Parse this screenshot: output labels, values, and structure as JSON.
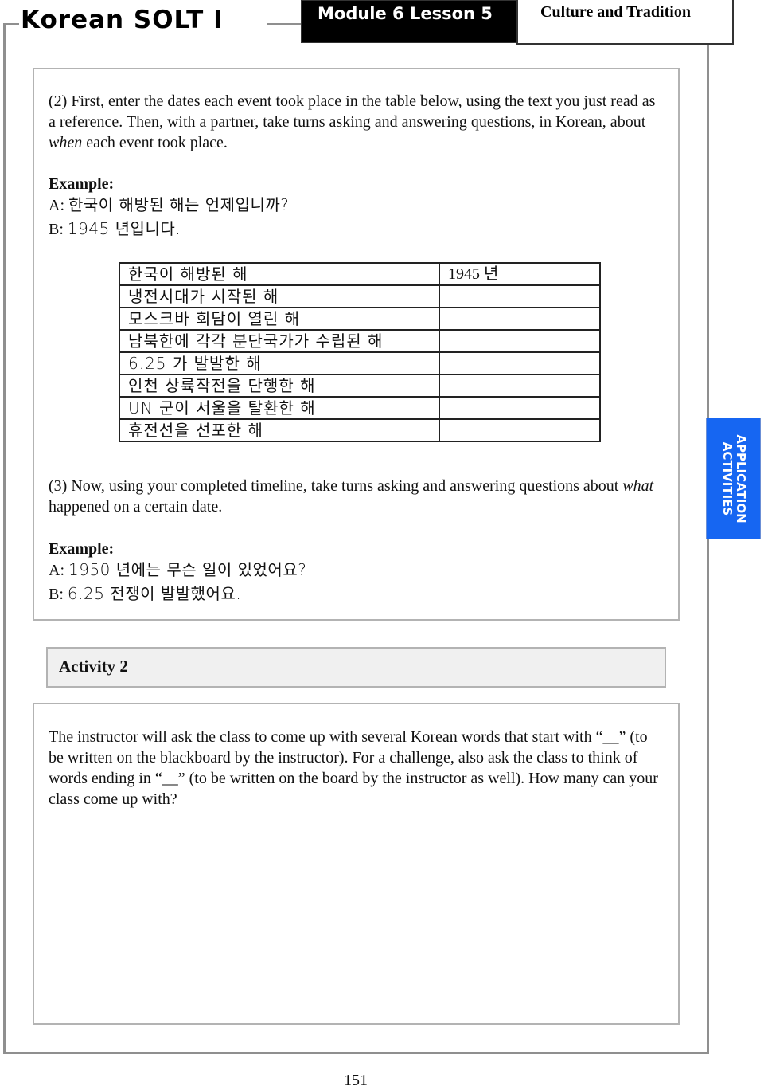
{
  "header": {
    "course_title": "Korean SOLT I",
    "module_label": "Module 6 Lesson 5",
    "topic_label": "Culture and Tradition"
  },
  "side_tab": {
    "line1": "APPLICATION",
    "line2": "ACTIVITIES",
    "color": "#1666f2"
  },
  "activity1": {
    "instruction_2": {
      "prefix": "(2) First, enter the dates each event took place in the table below, using the text you just read as a reference.  Then, with a partner, take turns asking and answering questions, in Korean, about ",
      "emphasis": "when",
      "suffix": " each event took place."
    },
    "example_label": "Example:",
    "example_a_prefix": "A: ",
    "example_a": "한국이 해방된 해는 언제입니까?",
    "example_b_prefix": "B: ",
    "example_b": "1945 년입니다.",
    "table": {
      "rows": [
        {
          "event": "한국이 해방된 해",
          "date": "1945 년"
        },
        {
          "event": "냉전시대가 시작된 해",
          "date": ""
        },
        {
          "event": "모스크바 회담이 열린 해",
          "date": ""
        },
        {
          "event": "남북한에 각각 분단국가가 수립된 해",
          "date": ""
        },
        {
          "event": "6.25 가 발발한 해",
          "date": ""
        },
        {
          "event": "인천 상륙작전을 단행한 해",
          "date": ""
        },
        {
          "event": "UN 군이 서울을 탈환한 해",
          "date": ""
        },
        {
          "event": "휴전선을 선포한 해",
          "date": ""
        }
      ]
    },
    "instruction_3": {
      "prefix": "(3) Now, using your completed timeline, take turns asking and answering questions about ",
      "emphasis": "what",
      "suffix": " happened on a certain date."
    },
    "example2_label": "Example:",
    "example2_a_prefix": "A: ",
    "example2_a": "1950 년에는 무슨 일이 있었어요?",
    "example2_b_prefix": "B: ",
    "example2_b": "6.25 전쟁이 발발했어요."
  },
  "activity2": {
    "title": "Activity 2",
    "body": "The instructor will ask the class to come up with several Korean words that start with “__” (to be written on the blackboard by the instructor).  For a challenge, also ask the class to think of words ending in “__” (to be written on the board by the instructor as well).  How many can your class come up with?"
  },
  "footer": {
    "page_number": "151"
  }
}
